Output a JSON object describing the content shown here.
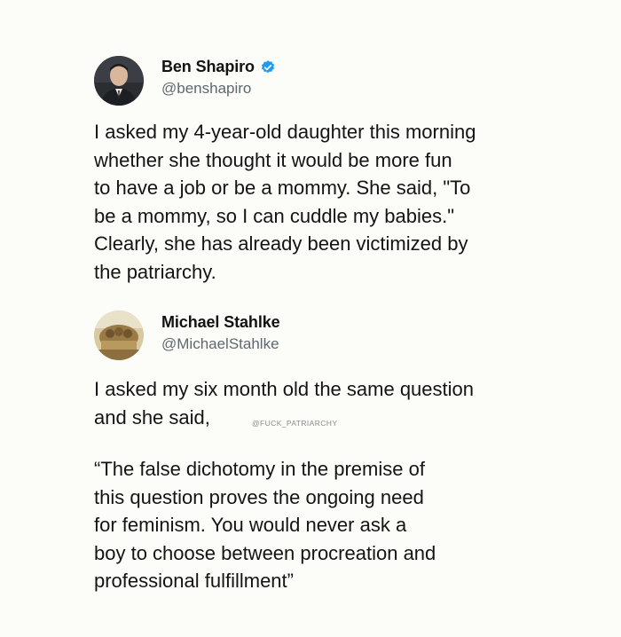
{
  "tweet1": {
    "display_name": "Ben Shapiro",
    "handle": "@benshapiro",
    "verified": true,
    "avatar_icon": "avatar-photo-ben-shapiro",
    "lines": [
      "I asked my 4-year-old daughter this morning",
      "whether she thought it would be more fun",
      "to have a job or be a mommy. She said, \"To",
      "be a mommy, so I can cuddle my babies.\"",
      "Clearly, she has already been victimized by",
      "the patriarchy."
    ]
  },
  "tweet2": {
    "display_name": "Michael Stahlke",
    "handle": "@MichaelStahlke",
    "verified": false,
    "avatar_icon": "avatar-photo-michael-stahlke",
    "lines_part1": [
      "I asked my six month old the same question",
      "and she said,"
    ],
    "lines_part2": [
      "“The false dichotomy in the premise of",
      "this question proves the ongoing need",
      "for feminism. You would never ask a",
      "boy to choose between procreation and",
      "professional fulfillment”"
    ]
  },
  "watermark": "@FUCK_PATRIARCHY",
  "colors": {
    "background": "#fcfcf9",
    "text": "#141414",
    "handle": "#5f6870",
    "verified_badge": "#1d9bf0"
  }
}
